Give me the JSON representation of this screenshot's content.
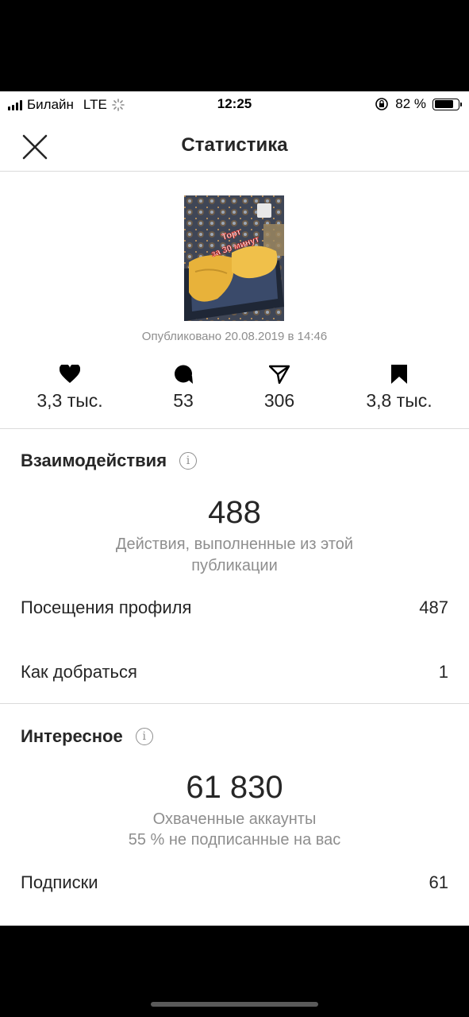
{
  "status_bar": {
    "carrier": "Билайн",
    "network": "LTE",
    "time": "12:25",
    "battery_text": "82 %",
    "battery_level": 0.82
  },
  "header": {
    "title": "Статистика",
    "close_icon": "close-icon"
  },
  "post": {
    "thumbnail_caption_line1": "Торт",
    "thumbnail_caption_line2": "за 30 минут",
    "published": "Опубликовано 20.08.2019 в 14:46"
  },
  "metrics": {
    "likes": "3,3 тыс.",
    "comments": "53",
    "shares": "306",
    "saves": "3,8 тыс."
  },
  "interactions": {
    "title": "Взаимодействия",
    "total": "488",
    "description_line1": "Действия, выполненные из этой",
    "description_line2": "публикации",
    "rows": [
      {
        "label": "Посещения профиля",
        "value": "487"
      },
      {
        "label": "Как добраться",
        "value": "1"
      }
    ]
  },
  "discovery": {
    "title": "Интересное",
    "total": "61 830",
    "description_line1": "Охваченные аккаунты",
    "description_line2": "55 % не подписанные на вас",
    "rows": [
      {
        "label": "Подписки",
        "value": "61"
      }
    ]
  }
}
